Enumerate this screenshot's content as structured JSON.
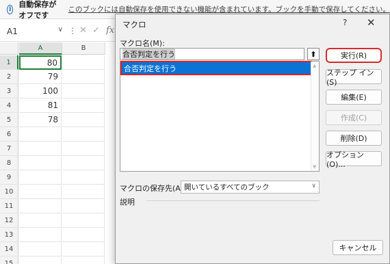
{
  "infobar": {
    "title": "自動保存がオフです",
    "message": "このブックには自動保存を使用できない機能が含まれています。ブックを手動で保存してください。",
    "icon": "info-icon"
  },
  "formula_bar": {
    "name_box": "A1",
    "name_box_chevron": "∨",
    "dots": "⋮",
    "cancel_glyph": "✕",
    "enter_glyph": "✓",
    "fx": "fx"
  },
  "sheet": {
    "columns": [
      "A",
      "B"
    ],
    "rows": [
      "1",
      "2",
      "3",
      "4",
      "5",
      "6",
      "7",
      "8",
      "9",
      "10",
      "11",
      "12",
      "13",
      "14",
      "15"
    ],
    "column_a_values": [
      "80",
      "79",
      "100",
      "81",
      "78"
    ],
    "active_cell": "A1"
  },
  "dialog": {
    "title": "マクロ",
    "help": "?",
    "close": "✕",
    "macro_name_label": "マクロ名(M):",
    "macro_name_value": "合否判定を行う",
    "upload_glyph": "⬆",
    "macro_list": [
      "合否判定を行う"
    ],
    "store_in_label": "マクロの保存先(A):",
    "store_in_value": "開いているすべてのブック",
    "description_label": "説明",
    "buttons": {
      "run": "実行(R)",
      "step_into": "ステップ イン(S)",
      "edit": "編集(E)",
      "create": "作成(C)",
      "delete": "削除(D)",
      "options": "オプション(O)...",
      "cancel": "キャンセル"
    }
  },
  "colors": {
    "selection": "#0b73d4",
    "highlight_border": "#e02020",
    "active_cell_border": "#1f7a3a"
  }
}
